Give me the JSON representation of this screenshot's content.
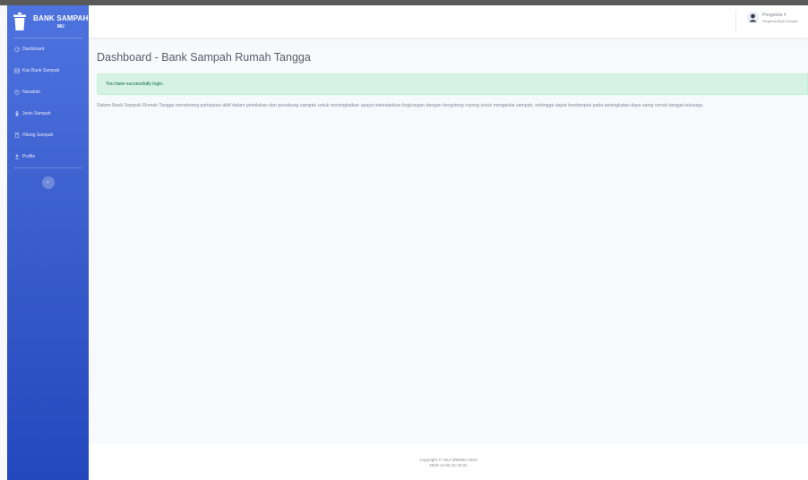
{
  "brand": {
    "name": "BANK SAMPAH",
    "sub": "MU"
  },
  "sidebar": {
    "items": [
      {
        "label": "Dashboard",
        "icon": "dashboard-icon"
      },
      {
        "label": "Kas Bank Sampah",
        "icon": "table-icon"
      },
      {
        "label": "Nasabah",
        "icon": "users-icon"
      },
      {
        "label": "Jenis Sampah",
        "icon": "trash-icon"
      },
      {
        "label": "Hitung Sampah",
        "icon": "calculator-icon"
      },
      {
        "label": "Profile",
        "icon": "user-icon"
      }
    ],
    "toggle": "‹"
  },
  "user": {
    "name": "Pengelola 4",
    "role": "Pengelola Bank Sampah"
  },
  "page": {
    "title": "Dashboard - Bank Sampah Rumah Tangga",
    "alert": "You have successfully login.",
    "description": "Sistem Bank Sampah Rumah Tangga mendorong partisipasi aktif dalam pemilahan dan penabung sampah untuk meningkatkan upaya melestarikan lingkungan dengan bergotong royong untuk mengelola sampah, sehingga dapat berdampak pada peningkatan daya saing rumah tangga keluarga."
  },
  "footer": {
    "copyright": "Copyright © Your Website 2023",
    "date": "2023-12-05 21:33:21"
  },
  "colors": {
    "sidebar": "#4e73df",
    "alert_bg": "#d5f2e5",
    "alert_text": "#0f6848"
  }
}
